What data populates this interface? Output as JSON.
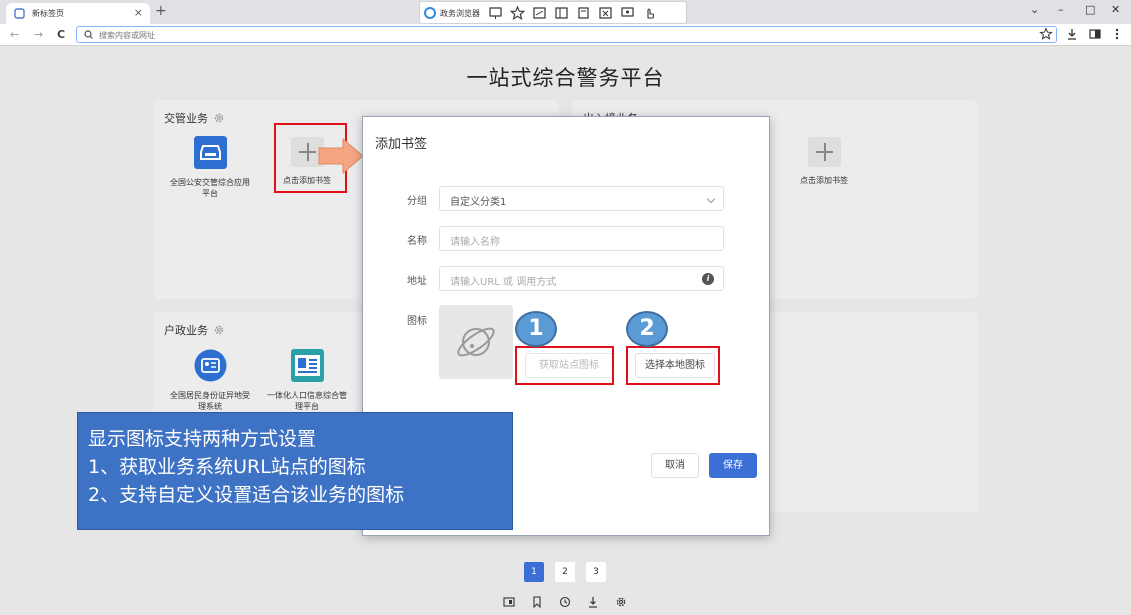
{
  "browser": {
    "tab_title": "新标签页",
    "tab_close": "×",
    "new_tab": "+",
    "center_toolbar_label": "政务浏览器",
    "center_toolbar_icons": [
      "translate-icon",
      "star-icon",
      "screenshot-icon",
      "sidebar-icon",
      "bookmark-icon",
      "capture-icon",
      "screen-icon",
      "gesture-icon"
    ],
    "window_controls": [
      "⌄",
      "–",
      "□",
      "✕"
    ],
    "nav": {
      "back": "←",
      "forward": "→",
      "reload": "C"
    },
    "address_placeholder": "搜索内容或网址",
    "address_icons": [
      "star-icon",
      "download-icon",
      "panel-icon",
      "more-icon"
    ]
  },
  "page": {
    "title": "一站式综合警务平台",
    "panels": [
      {
        "header": "交管业务",
        "apps": [
          {
            "label": "全国公安交管综合应用平台",
            "icon": "police-car-icon"
          },
          {
            "label": "点击添加书签",
            "icon": "add-icon"
          }
        ]
      },
      {
        "header": "出入境业务",
        "apps": [
          {
            "label": "点击添加书签",
            "icon": "add-icon"
          }
        ]
      },
      {
        "header": "户政业务",
        "apps": [
          {
            "label": "全国居民身份证异地受理系统",
            "icon": "id-card-icon"
          },
          {
            "label": "一体化人口信息综合管理平台",
            "icon": "population-icon"
          }
        ]
      }
    ]
  },
  "modal": {
    "title": "添加书签",
    "group_label": "分组",
    "group_value": "自定义分类1",
    "name_label": "名称",
    "name_placeholder": "请输入名称",
    "url_label": "地址",
    "url_placeholder": "请输入URL 或 调用方式",
    "icon_label": "图标",
    "fetch_icon_button": "获取站点图标",
    "choose_local_button": "选择本地图标",
    "cancel_button": "取消",
    "save_button": "保存"
  },
  "badges": [
    "1",
    "2"
  ],
  "callout": {
    "lines": [
      "显示图标支持两种方式设置",
      "1、获取业务系统URL站点的图标",
      "2、支持自定义设置适合该业务的图标"
    ]
  },
  "pagination": {
    "pages": [
      "1",
      "2",
      "3"
    ],
    "current": "1"
  },
  "bottom_icons": [
    "wallpaper-icon",
    "bookmark-icon",
    "history-icon",
    "download-icon",
    "settings-icon"
  ],
  "colors": {
    "primary": "#3b6fd6",
    "annotation_red": "#e0101a",
    "callout_blue": "#3e72c4",
    "badge_blue": "#5b9bd5",
    "arrow_orange": "#f4a582"
  }
}
